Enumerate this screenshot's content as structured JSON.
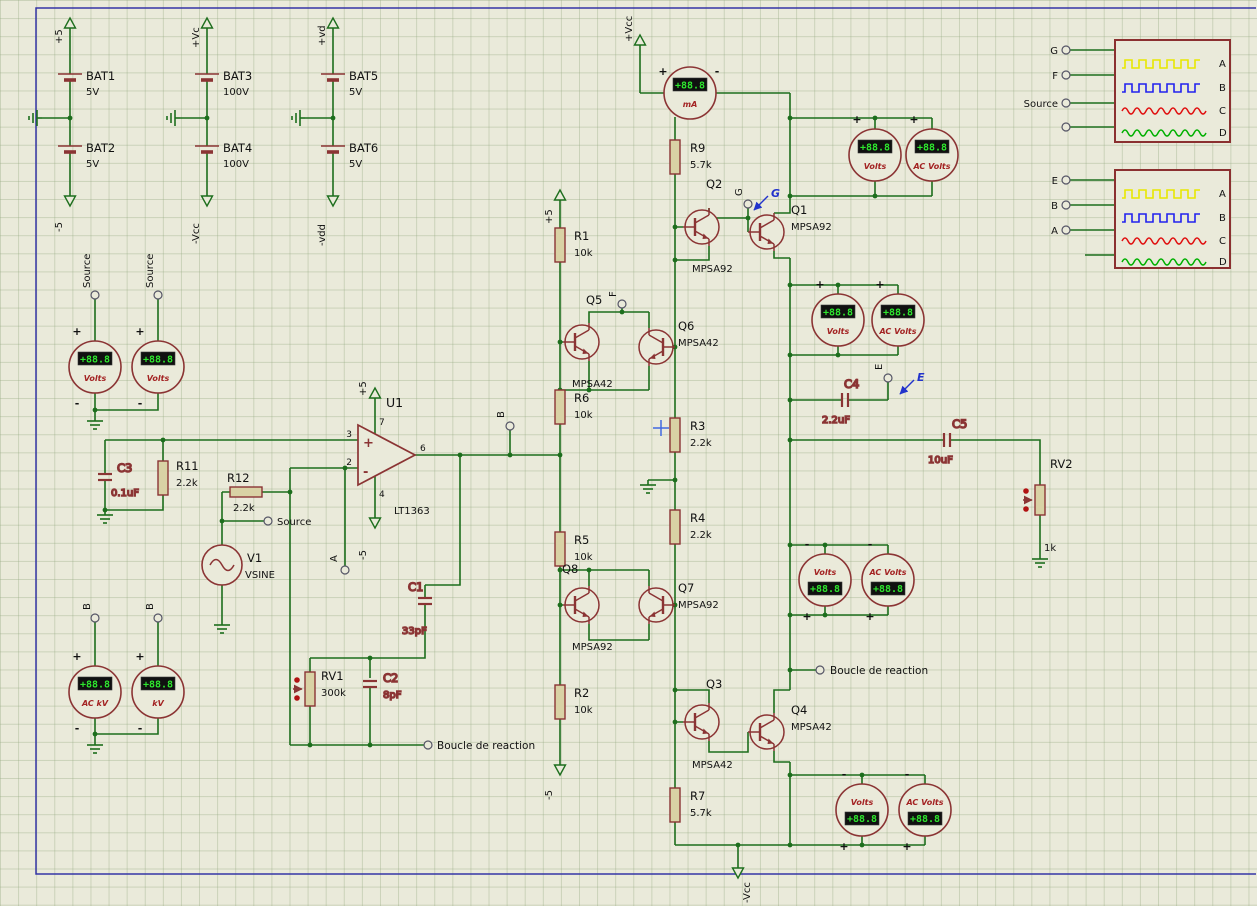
{
  "colors": {
    "background": "#eaeada",
    "grid": "#96aa82",
    "sheet_border": "#3434a6",
    "wire": "#1d6e1d",
    "component": "#8b3434",
    "resistor_fill": "#d9d2a5",
    "display_background": "#101010",
    "display_text": "#2ee62e",
    "meter_unit_label": "#a32222",
    "probe_blue": "#2233cc",
    "waveform_yellow": "#e8e800",
    "waveform_blue": "#2222ee",
    "waveform_red": "#e01010",
    "waveform_green": "#00b000"
  },
  "power_flags": {
    "p5": "+5",
    "m5": "-5",
    "pvc": "+Vc",
    "mvcc": "-Vcc",
    "pvd": "+vd",
    "mvdd": "-vdd",
    "pvcc": "+Vcc"
  },
  "batteries": [
    {
      "name": "BAT1",
      "value": "5V"
    },
    {
      "name": "BAT2",
      "value": "5V"
    },
    {
      "name": "BAT3",
      "value": "100V"
    },
    {
      "name": "BAT4",
      "value": "100V"
    },
    {
      "name": "BAT5",
      "value": "5V"
    },
    {
      "name": "BAT6",
      "value": "5V"
    }
  ],
  "resistors": [
    {
      "name": "R1",
      "value": "10k"
    },
    {
      "name": "R2",
      "value": "10k"
    },
    {
      "name": "R3",
      "value": "2.2k"
    },
    {
      "name": "R4",
      "value": "2.2k"
    },
    {
      "name": "R5",
      "value": "10k"
    },
    {
      "name": "R6",
      "value": "10k"
    },
    {
      "name": "R7",
      "value": "5.7k"
    },
    {
      "name": "R9",
      "value": "5.7k"
    },
    {
      "name": "R11",
      "value": "2.2k"
    },
    {
      "name": "R12",
      "value": "2.2k"
    }
  ],
  "capacitors": [
    {
      "name": "C1",
      "value": "33pF"
    },
    {
      "name": "C2",
      "value": "8pF"
    },
    {
      "name": "C3",
      "value": "0.1uF"
    },
    {
      "name": "C4",
      "value": "2.2uF"
    },
    {
      "name": "C5",
      "value": "10uF"
    }
  ],
  "potentiometers": [
    {
      "name": "RV1",
      "value": "300k"
    },
    {
      "name": "RV2",
      "value": "1k"
    }
  ],
  "transistors": [
    {
      "name": "Q1",
      "part": "MPSA92"
    },
    {
      "name": "Q2",
      "part": "MPSA92"
    },
    {
      "name": "Q3",
      "part": "MPSA42"
    },
    {
      "name": "Q4",
      "part": "MPSA42"
    },
    {
      "name": "Q5",
      "part": "MPSA42"
    },
    {
      "name": "Q6",
      "part": "MPSA42"
    },
    {
      "name": "Q7",
      "part": "MPSA92"
    },
    {
      "name": "Q8",
      "part": "MPSA92"
    }
  ],
  "opamp": {
    "name": "U1",
    "part": "LT1363",
    "pin_plus": "3",
    "pin_minus": "2",
    "pin_out": "6",
    "pin_vplus": "7",
    "pin_vminus": "4",
    "plus": "+",
    "minus": "-"
  },
  "source": {
    "name": "V1",
    "value": "VSINE"
  },
  "meters": {
    "display": "+88.8",
    "plus": "+",
    "minus": "-",
    "ma": "mA",
    "volts": "Volts",
    "ac_volts": "AC Volts",
    "ac_kv": "AC kV",
    "kv": "kV"
  },
  "terminals": {
    "a": "A",
    "b": "B",
    "e": "E",
    "f": "F",
    "g": "G",
    "source": "Source",
    "feedback": "Boucle de reaction"
  },
  "probes": {
    "g": "G",
    "e": "E"
  },
  "scope": {
    "channels": [
      "A",
      "B",
      "C",
      "D"
    ],
    "box1_inputs": [
      "G",
      "F",
      "Source"
    ],
    "box2_inputs": [
      "E",
      "B",
      "A"
    ]
  }
}
